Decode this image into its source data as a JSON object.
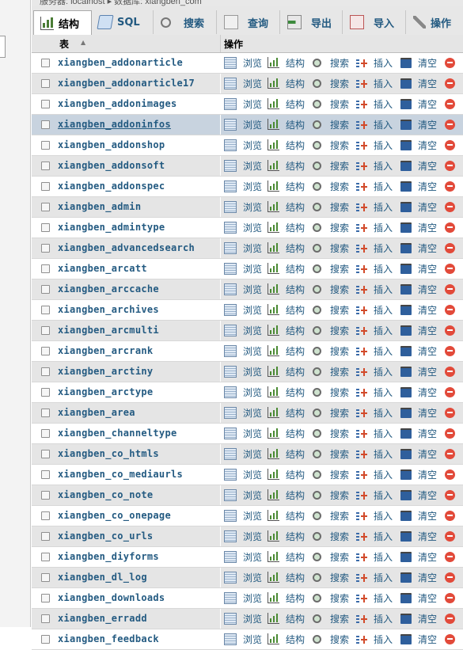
{
  "top_strip_text": "服务器: localhost ▸ 数据库: xiangben_com",
  "tabs": [
    {
      "id": "structure",
      "label": "结构",
      "icon": "structure-icon",
      "active": true
    },
    {
      "id": "sql",
      "label": "SQL",
      "icon": "sql-icon",
      "active": false
    },
    {
      "id": "search",
      "label": "搜索",
      "icon": "search-icon",
      "active": false
    },
    {
      "id": "query",
      "label": "查询",
      "icon": "query-icon",
      "active": false
    },
    {
      "id": "export",
      "label": "导出",
      "icon": "export-icon",
      "active": false
    },
    {
      "id": "import",
      "label": "导入",
      "icon": "import-icon",
      "active": false
    },
    {
      "id": "operations",
      "label": "操作",
      "icon": "wrench-icon",
      "active": false
    }
  ],
  "header": {
    "table_col": "表",
    "sort_indicator": "▲",
    "ops_col": "操作"
  },
  "actions": {
    "browse": "浏览",
    "structure": "结构",
    "search": "搜索",
    "insert": "插入",
    "empty": "清空"
  },
  "highlighted_row_index": 3,
  "rows": [
    "xiangben_addonarticle",
    "xiangben_addonarticle17",
    "xiangben_addonimages",
    "xiangben_addoninfos",
    "xiangben_addonshop",
    "xiangben_addonsoft",
    "xiangben_addonspec",
    "xiangben_admin",
    "xiangben_admintype",
    "xiangben_advancedsearch",
    "xiangben_arcatt",
    "xiangben_arccache",
    "xiangben_archives",
    "xiangben_arcmulti",
    "xiangben_arcrank",
    "xiangben_arctiny",
    "xiangben_arctype",
    "xiangben_area",
    "xiangben_channeltype",
    "xiangben_co_htmls",
    "xiangben_co_mediaurls",
    "xiangben_co_note",
    "xiangben_co_onepage",
    "xiangben_co_urls",
    "xiangben_diyforms",
    "xiangben_dl_log",
    "xiangben_downloads",
    "xiangben_erradd",
    "xiangben_feedback"
  ]
}
